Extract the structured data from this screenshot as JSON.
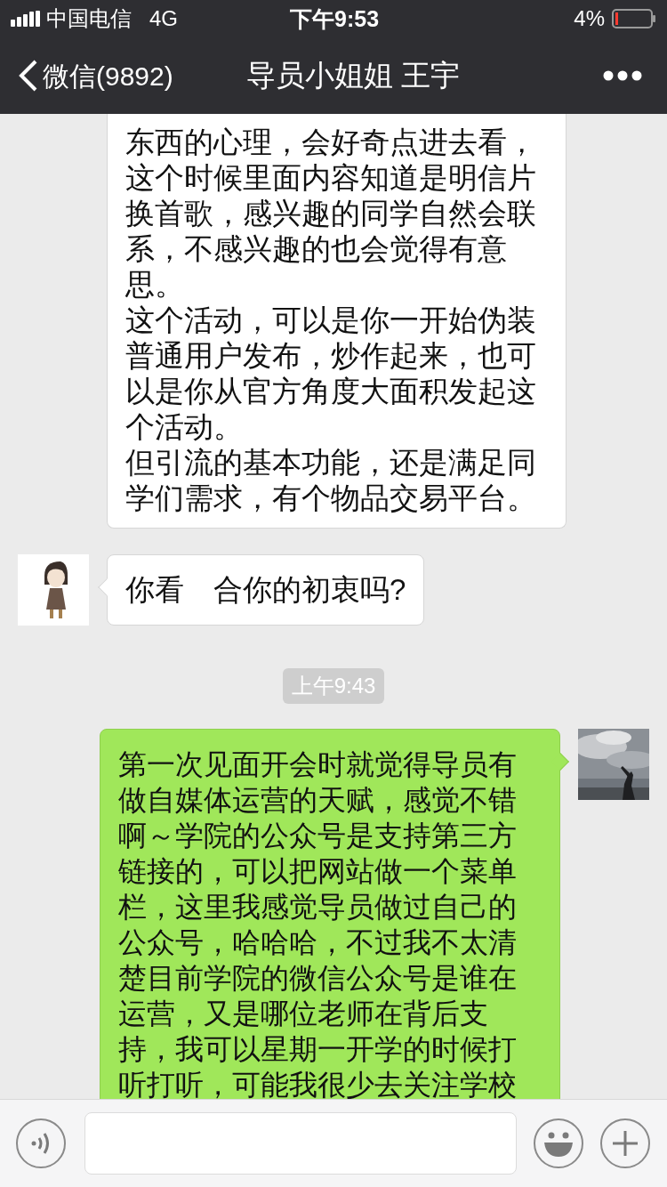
{
  "status_bar": {
    "carrier": "中国电信",
    "network": "4G",
    "time": "下午9:53",
    "battery": "4%"
  },
  "nav": {
    "back_label": "微信(9892)",
    "title": "导员小姐姐 王宇"
  },
  "messages": [
    {
      "kind": "text",
      "sent": false,
      "avatar": false,
      "paragraphs": [
        "东西的心理，会好奇点进去看，这个时候里面内容知道是明信片换首歌，感兴趣的同学自然会联系，不感兴趣的也会觉得有意思。",
        "这个活动，可以是你一开始伪装普通用户发布，炒作起来，也可以是你从官方角度大面积发起这个活动。",
        "但引流的基本功能，还是满足同学们需求，有个物品交易平台。"
      ]
    },
    {
      "kind": "text",
      "sent": false,
      "avatar": true,
      "paragraphs": [
        "你看　合你的初衷吗?"
      ]
    },
    {
      "kind": "time",
      "text": "上午9:43"
    },
    {
      "kind": "text",
      "sent": true,
      "avatar": true,
      "paragraphs": [
        "第一次见面开会时就觉得导员有做自媒体运营的天赋，感觉不错啊～学院的公众号是支持第三方链接的，可以把网站做一个菜单栏，这里我感觉导员做过自己的公众号，哈哈哈，不过我不太清楚目前学院的微信公众号是谁在运营，又是哪位老师在背后支持，我可以星期一开学的时候打听打听，可能我很少去关注学校"
      ]
    }
  ]
}
